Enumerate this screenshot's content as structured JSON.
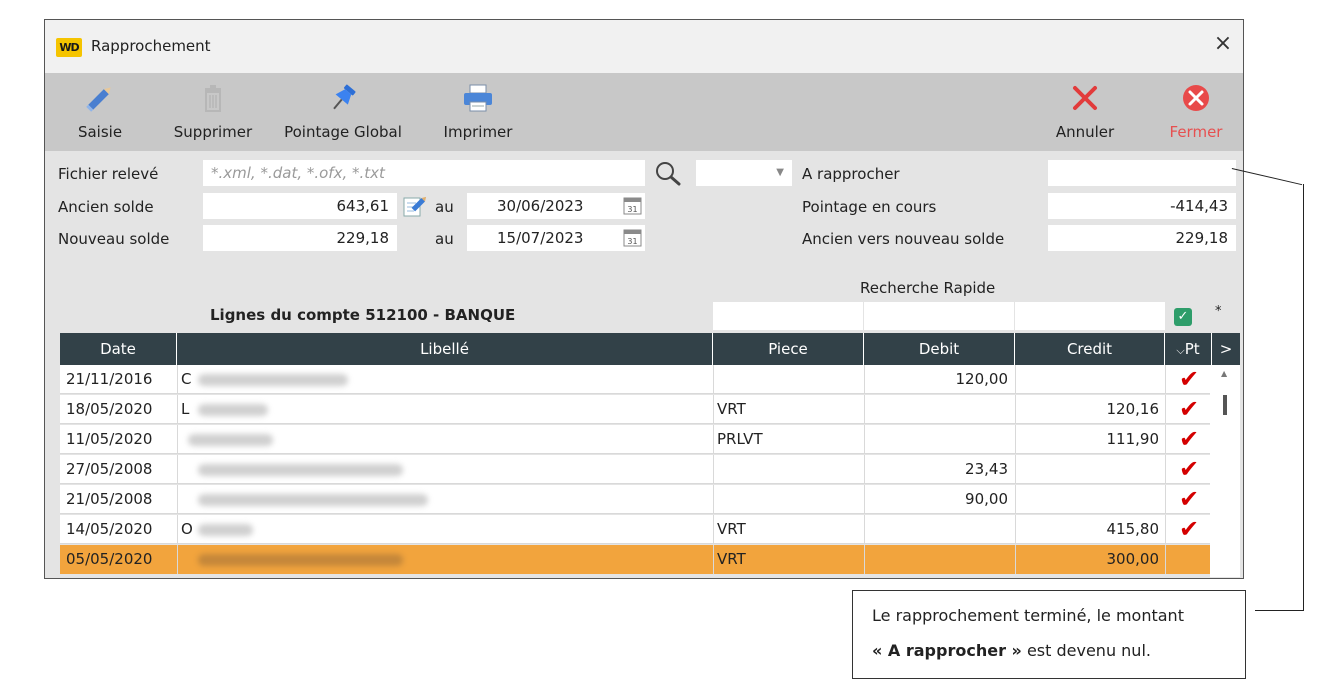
{
  "window": {
    "title": "Rapprochement",
    "logo_text": "WD",
    "close_symbol": "×"
  },
  "toolbar": {
    "saisie": "Saisie",
    "supprimer": "Supprimer",
    "pointage_global": "Pointage Global",
    "imprimer": "Imprimer",
    "annuler": "Annuler",
    "fermer": "Fermer"
  },
  "form": {
    "fichier_label": "Fichier relevé",
    "fichier_placeholder": "*.xml, *.dat, *.ofx, *.txt",
    "ancien_label": "Ancien solde",
    "ancien_value": "643,61",
    "ancien_au": "au",
    "ancien_date": "30/06/2023",
    "nouveau_label": "Nouveau solde",
    "nouveau_value": "229,18",
    "nouveau_au": "au",
    "nouveau_date": "15/07/2023",
    "calendar_day": "31",
    "a_rapprocher_label": "A rapprocher",
    "a_rapprocher_value": "",
    "pointage_label": "Pointage en cours",
    "pointage_value": "-414,43",
    "ancien_nouveau_label": "Ancien vers nouveau solde",
    "ancien_nouveau_value": "229,18"
  },
  "grid": {
    "title": "Lignes du compte 512100 - BANQUE",
    "recherche_label": "Recherche Rapide",
    "asterisk": "*",
    "columns": {
      "date": "Date",
      "libelle": "Libellé",
      "piece": "Piece",
      "debit": "Debit",
      "credit": "Credit",
      "pt": "Pt",
      "more": ">"
    },
    "rows": [
      {
        "date": "21/11/2016",
        "libelle": "C",
        "piece": "",
        "debit": "120,00",
        "credit": "",
        "pointed": true
      },
      {
        "date": "18/05/2020",
        "libelle": "L",
        "piece": "VRT",
        "debit": "",
        "credit": "120,16",
        "pointed": true
      },
      {
        "date": "11/05/2020",
        "libelle": "",
        "piece": "PRLVT",
        "debit": "",
        "credit": "111,90",
        "pointed": true
      },
      {
        "date": "27/05/2008",
        "libelle": "",
        "piece": "",
        "debit": "23,43",
        "credit": "",
        "pointed": true
      },
      {
        "date": "21/05/2008",
        "libelle": "",
        "piece": "",
        "debit": "90,00",
        "credit": "",
        "pointed": true
      },
      {
        "date": "14/05/2020",
        "libelle": "O",
        "piece": "VRT",
        "debit": "",
        "credit": "415,80",
        "pointed": true
      },
      {
        "date": "05/05/2020",
        "libelle": "",
        "piece": "VRT",
        "debit": "",
        "credit": "300,00",
        "pointed": false,
        "selected": true
      }
    ]
  },
  "callout": {
    "line1": "Le rapprochement terminé, le montant",
    "line2_bold": "« A rapprocher »",
    "line2_rest": " est devenu nul."
  },
  "colors": {
    "toolbar_bg": "#c8c8c8",
    "header_bg": "#324148",
    "selected_row": "#f2a43d",
    "check_red": "#d40000",
    "fermer_red": "#e65050"
  }
}
